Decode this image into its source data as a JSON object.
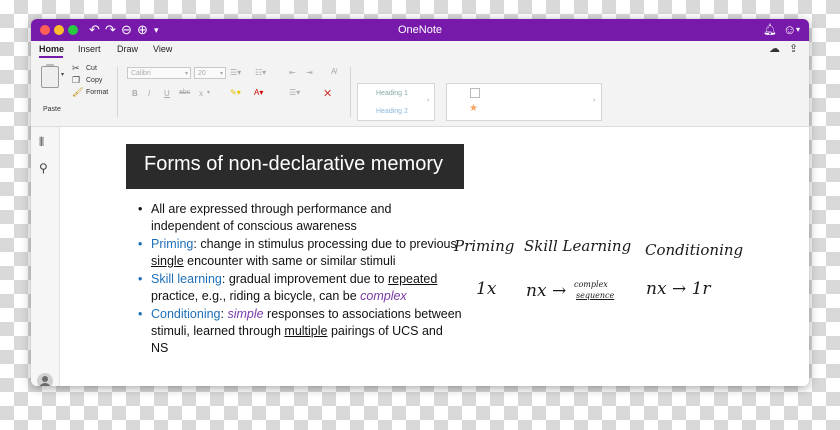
{
  "window": {
    "title": "OneNote",
    "accent_color": "#7719aa",
    "titlebar_icons": [
      "undo-icon",
      "redo-icon",
      "back-icon",
      "forward-icon",
      "customize-icon",
      "bell-icon",
      "smiley-feedback-icon"
    ]
  },
  "menu": {
    "tabs": [
      "Home",
      "Insert",
      "Draw",
      "View"
    ],
    "active_tab": "Home"
  },
  "ribbon": {
    "paste_label": "Paste",
    "cut_label": "Cut",
    "copy_label": "Copy",
    "format_label": "Format",
    "font_name": "Calibri",
    "font_size": "20",
    "bold": "B",
    "italic": "I",
    "underline": "U",
    "strike": "abc",
    "subscript": "x",
    "styles": [
      "Heading 1",
      "Heading 2"
    ]
  },
  "note": {
    "title": "Forms of non-declarative memory",
    "bullet_1": "All are expressed through performance and independent of conscious awareness",
    "bullet_2_term": "Priming",
    "bullet_2_before": ": change in stimulus processing due to previous ",
    "bullet_2_ul": "single",
    "bullet_2_after": " encounter with same or similar stimuli",
    "bullet_3_term": "Skill learning",
    "bullet_3_before": ": gradual improvement due to ",
    "bullet_3_ul": "repeated",
    "bullet_3_mid": " practice, e.g., riding a bicycle, can be ",
    "bullet_3_em": "complex",
    "bullet_4_term": "Conditioning",
    "bullet_4_sep": ": ",
    "bullet_4_em": "simple",
    "bullet_4_before": " responses to associations between stimuli, learned through ",
    "bullet_4_ul": "multiple",
    "bullet_4_after": " pairings of UCS and NS"
  },
  "handwriting": {
    "col1_header": "Priming",
    "col2_header": "Skill Learning",
    "col3_header": "Conditioning",
    "col1_value": "1x",
    "col2_value": "nx →",
    "col2_note_line1": "complex",
    "col2_note_line2": "sequence",
    "col3_value": "nx → 1r"
  }
}
